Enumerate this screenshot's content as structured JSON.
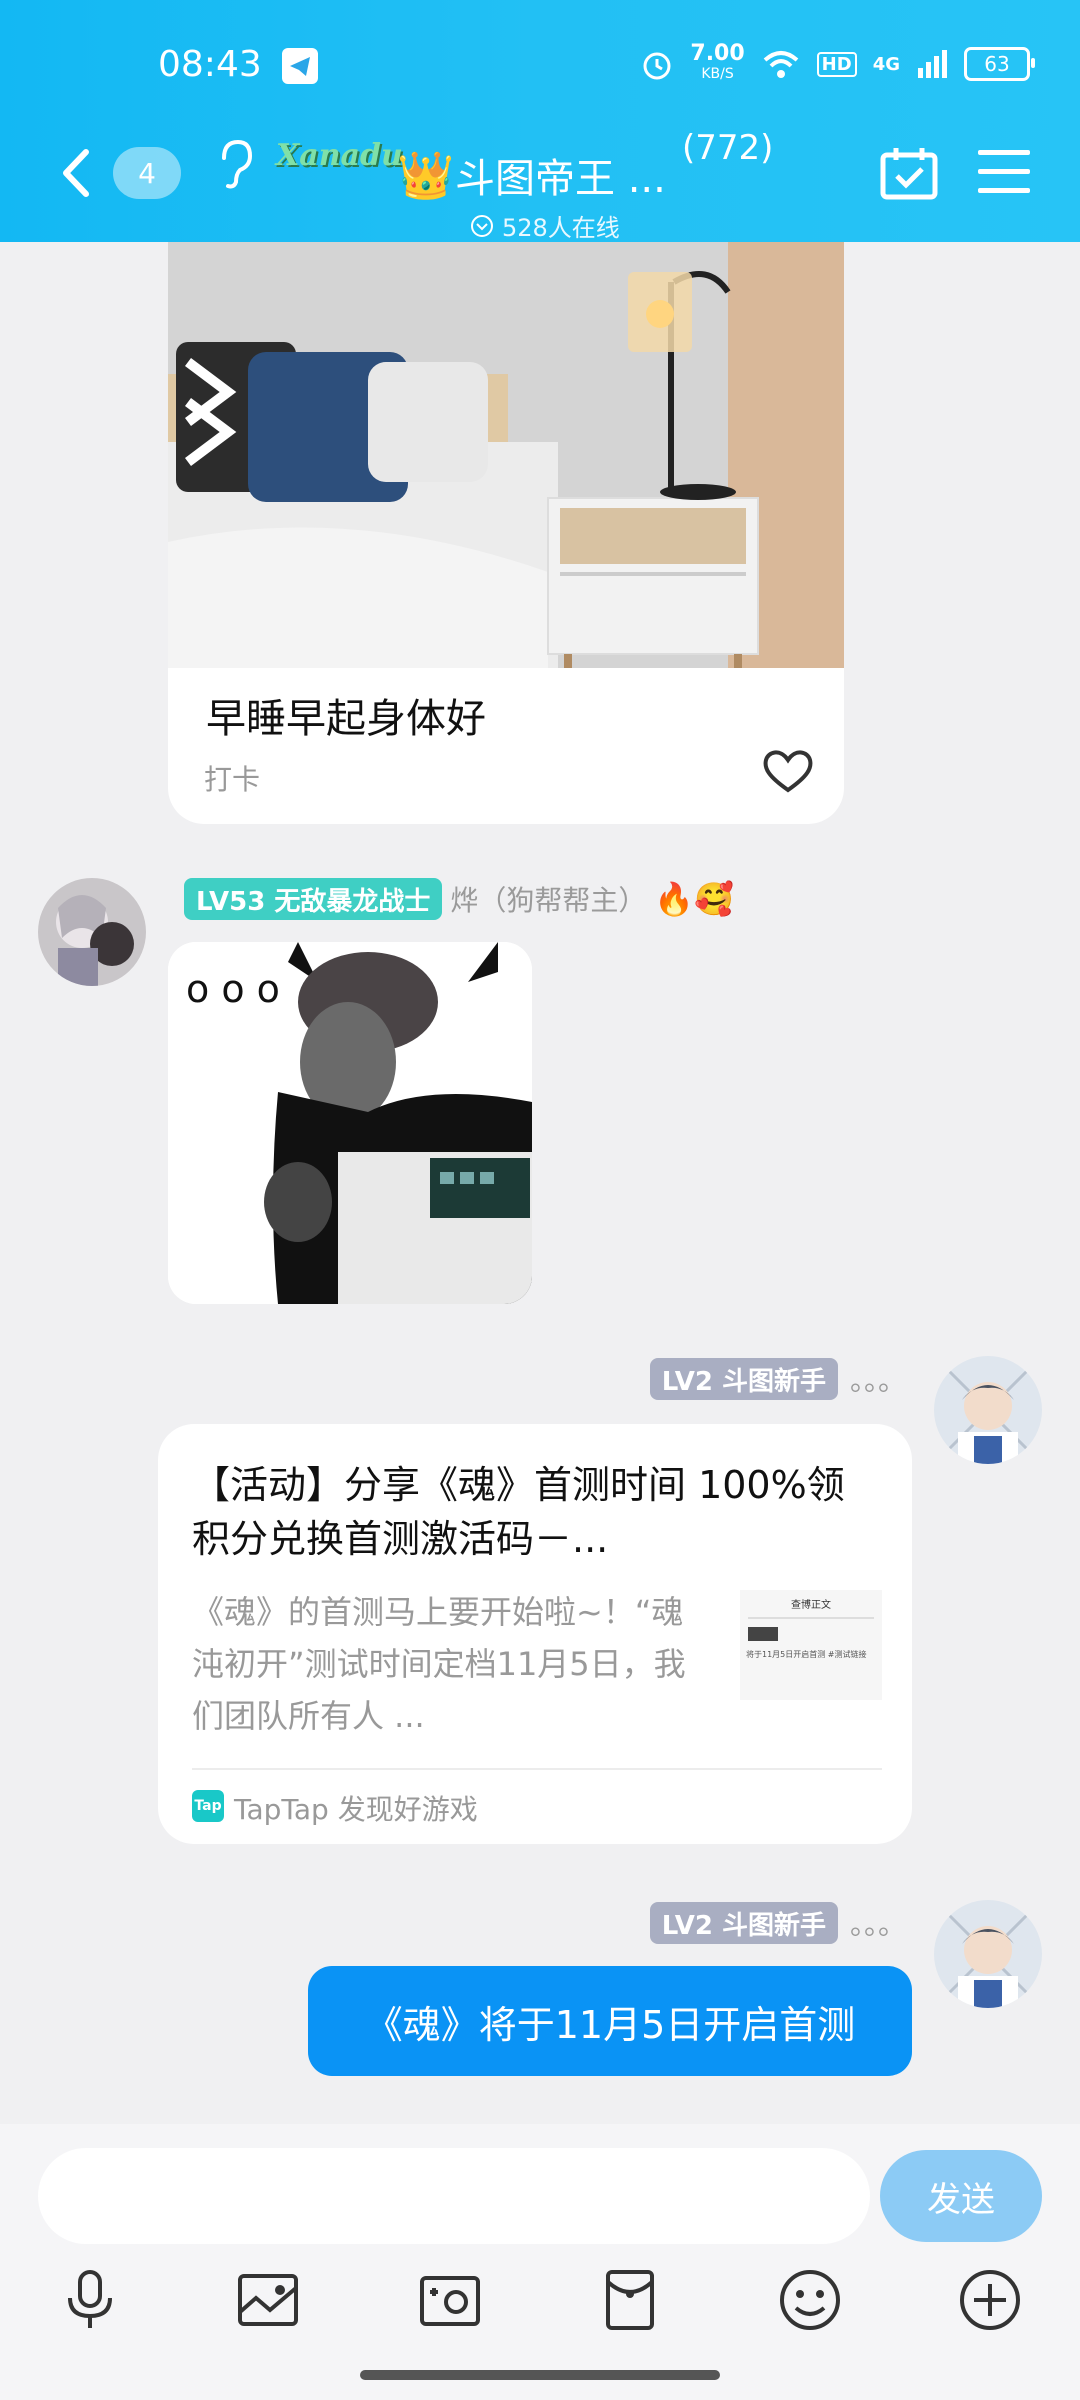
{
  "status_bar": {
    "time": "08:43",
    "net_speed_value": "7.00",
    "net_speed_unit": "KB/S",
    "hd_label": "HD",
    "signal_label": "4G",
    "battery": "63"
  },
  "header": {
    "unread_count": "4",
    "brand_logo_text": "Xanadu",
    "crown": "👑",
    "group_name": "斗图帝王 ...",
    "member_count": "(772)",
    "online_text": "528人在线"
  },
  "messages": {
    "photo_card": {
      "title": "早睡早起身体好",
      "subtitle": "打卡"
    },
    "msg2": {
      "level": "LV53 无敌暴龙战士",
      "nickname": "烨（狗帮帮主）",
      "badges": "🔥🥰",
      "sticker_text": "o o o"
    },
    "msg3": {
      "level": "LV2 斗图新手",
      "nickname": "。。。",
      "share_title": "【活动】分享《魂》首测时间 100%领积分兑换首测激活码－...",
      "share_desc": "《魂》的首测马上要开始啦~！“魂沌初开”测试时间定档11月5日，我们团队所有人 ...",
      "thumb_header": "查博正文",
      "thumb_line": "将于11月5日开启首测 #测试链接",
      "source_icon": "Tap",
      "source": "TapTap 发现好游戏"
    },
    "msg4": {
      "level": "LV2 斗图新手",
      "nickname": "。。。",
      "text": "《魂》将于11月5日开启首测"
    }
  },
  "composer": {
    "input_value": "",
    "send_label": "发送"
  },
  "colors": {
    "header": "#1cbcf4",
    "bubble": "#0a93f5",
    "level_teal": "#3fcfc4",
    "level_gray": "#a9aec2",
    "send_button": "#8ccbf5"
  },
  "toolbar_icons": [
    "microphone-icon",
    "image-icon",
    "camera-icon",
    "red-packet-icon",
    "emoji-icon",
    "plus-icon"
  ]
}
